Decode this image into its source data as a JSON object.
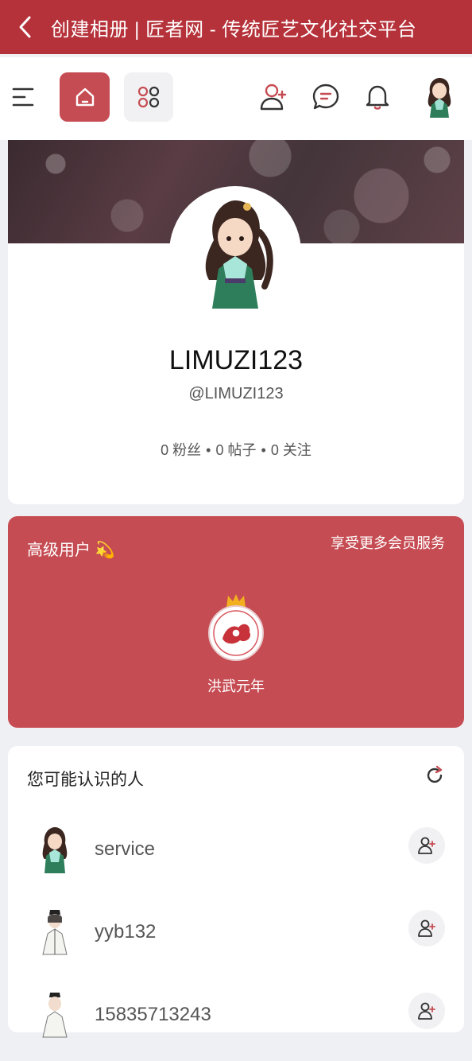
{
  "titlebar": {
    "title": "创建相册 | 匠者网 - 传统匠艺文化社交平台"
  },
  "colors": {
    "brand_red": "#b6323a",
    "accent_red": "#c64c53"
  },
  "profile": {
    "name": "LIMUZI123",
    "handle": "@LIMUZI123",
    "stats": {
      "fans": "0 粉丝",
      "posts": "0 帖子",
      "following": "0 关注",
      "separator": "•"
    }
  },
  "membership": {
    "title": "高级用户 💫",
    "link": "享受更多会员服务",
    "badge_label": "洪武元年"
  },
  "people": {
    "title": "您可能认识的人",
    "items": [
      {
        "name": "service"
      },
      {
        "name": "yyb132"
      },
      {
        "name": "15835713243"
      }
    ]
  }
}
